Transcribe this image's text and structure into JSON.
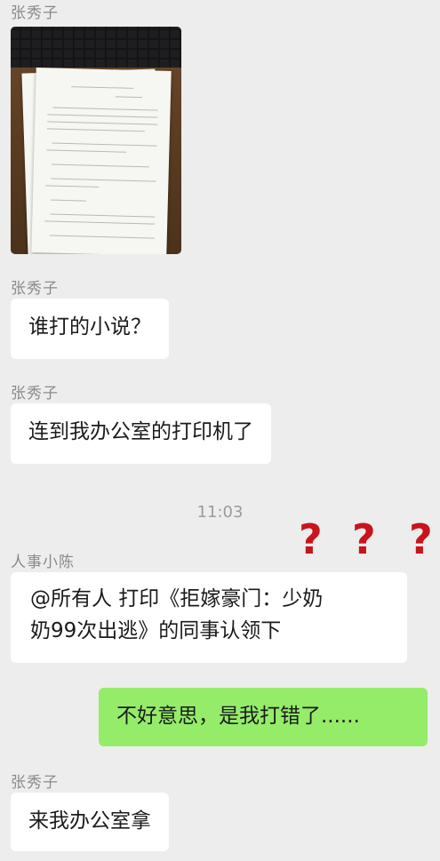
{
  "messages": [
    {
      "sender": "张秀子",
      "type": "image",
      "image_alt": "photo-of-printed-pages"
    },
    {
      "sender": "张秀子",
      "text": "谁打的小说？"
    },
    {
      "sender": "张秀子",
      "text": "连到我办公室的打印机了"
    },
    {
      "timestamp": "11:03"
    },
    {
      "sender": "人事小陈",
      "text_line1": "@所有人 打印《拒嫁豪门：少奶",
      "text_line2": "奶99次出逃》的同事认领下"
    },
    {
      "sender": "me",
      "text": "不好意思，是我打错了......"
    },
    {
      "sender": "张秀子",
      "text": "来我办公室拿"
    }
  ],
  "overlay": {
    "question_marks": [
      "?",
      "?",
      "?"
    ],
    "color": "#c8141b"
  },
  "colors": {
    "background": "#ededed",
    "incoming_bubble": "#ffffff",
    "outgoing_bubble": "#95ec69"
  }
}
